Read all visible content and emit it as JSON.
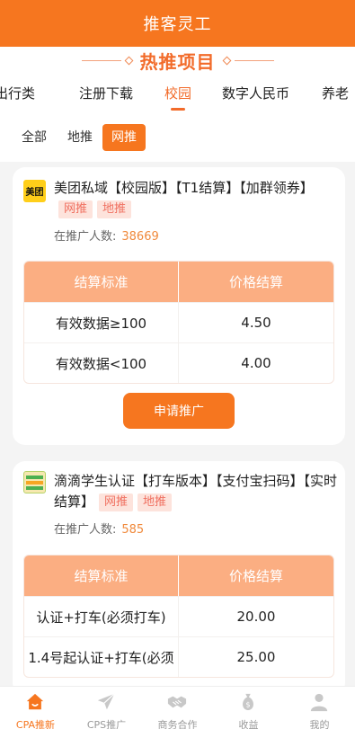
{
  "header": {
    "title": "推客灵工"
  },
  "hero": {
    "title": "热推项目"
  },
  "category_tabs": [
    {
      "label": "出行类",
      "active": false
    },
    {
      "label": "注册下载",
      "active": false
    },
    {
      "label": "校园",
      "active": true
    },
    {
      "label": "数字人民币",
      "active": false
    },
    {
      "label": "养老",
      "active": false
    }
  ],
  "filters": [
    {
      "label": "全部",
      "active": false
    },
    {
      "label": "地推",
      "active": false
    },
    {
      "label": "网推",
      "active": true
    }
  ],
  "projects": [
    {
      "logo_text": "美团",
      "title": "美团私域【校园版】【T1结算】【加群领券】",
      "tags": [
        "网推",
        "地推"
      ],
      "promoters_label": "在推广人数:",
      "promoters_count": "38669",
      "table": {
        "headers": [
          "结算标准",
          "价格结算"
        ],
        "rows": [
          [
            "有效数据≥100",
            "4.50"
          ],
          [
            "有效数据<100",
            "4.00"
          ]
        ]
      },
      "apply_label": "申请推广"
    },
    {
      "logo_text": "",
      "title": "滴滴学生认证【打车版本】【支付宝扫码】【实时结算】",
      "tags": [
        "网推",
        "地推"
      ],
      "promoters_label": "在推广人数:",
      "promoters_count": "585",
      "table": {
        "headers": [
          "结算标准",
          "价格结算"
        ],
        "rows": [
          [
            "认证+打车(必须打车)",
            "20.00"
          ],
          [
            "1.4号起认证+打车(必须",
            "25.00"
          ]
        ]
      }
    }
  ],
  "bottom_nav": [
    {
      "label": "CPA推新",
      "icon": "home-icon",
      "active": true
    },
    {
      "label": "CPS推广",
      "icon": "send-icon",
      "active": false
    },
    {
      "label": "商务合作",
      "icon": "handshake-icon",
      "active": false
    },
    {
      "label": "收益",
      "icon": "money-bag-icon",
      "active": false
    },
    {
      "label": "我的",
      "icon": "user-icon",
      "active": false
    }
  ],
  "colors": {
    "brand": "#f6761f",
    "accent_text": "#f26b2a",
    "tag_bg": "#fde3dc",
    "table_header": "#fbae82"
  }
}
